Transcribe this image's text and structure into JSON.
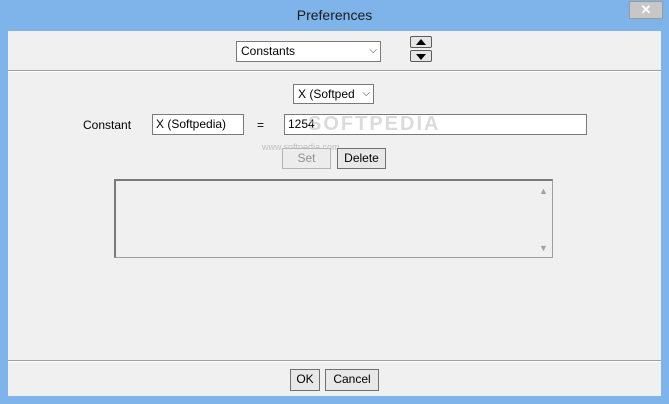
{
  "window": {
    "title": "Preferences",
    "close_glyph": "✕"
  },
  "category": {
    "selected": "Constants",
    "spinner_up_icon": "triangle-up-icon",
    "spinner_down_icon": "triangle-down-icon"
  },
  "constants": {
    "dropdown_selected": "X (Softped",
    "label": "Constant",
    "name_value": "X (Softpedia)",
    "equals": "=",
    "value": "1254",
    "set_label": "Set",
    "delete_label": "Delete",
    "list_items": []
  },
  "watermark": {
    "main": "SOFTPEDIA",
    "sub": "www.softpedia.com"
  },
  "footer": {
    "ok_label": "OK",
    "cancel_label": "Cancel"
  },
  "colors": {
    "title_bar": "#7eb4ea",
    "client": "#f0f0f0"
  }
}
